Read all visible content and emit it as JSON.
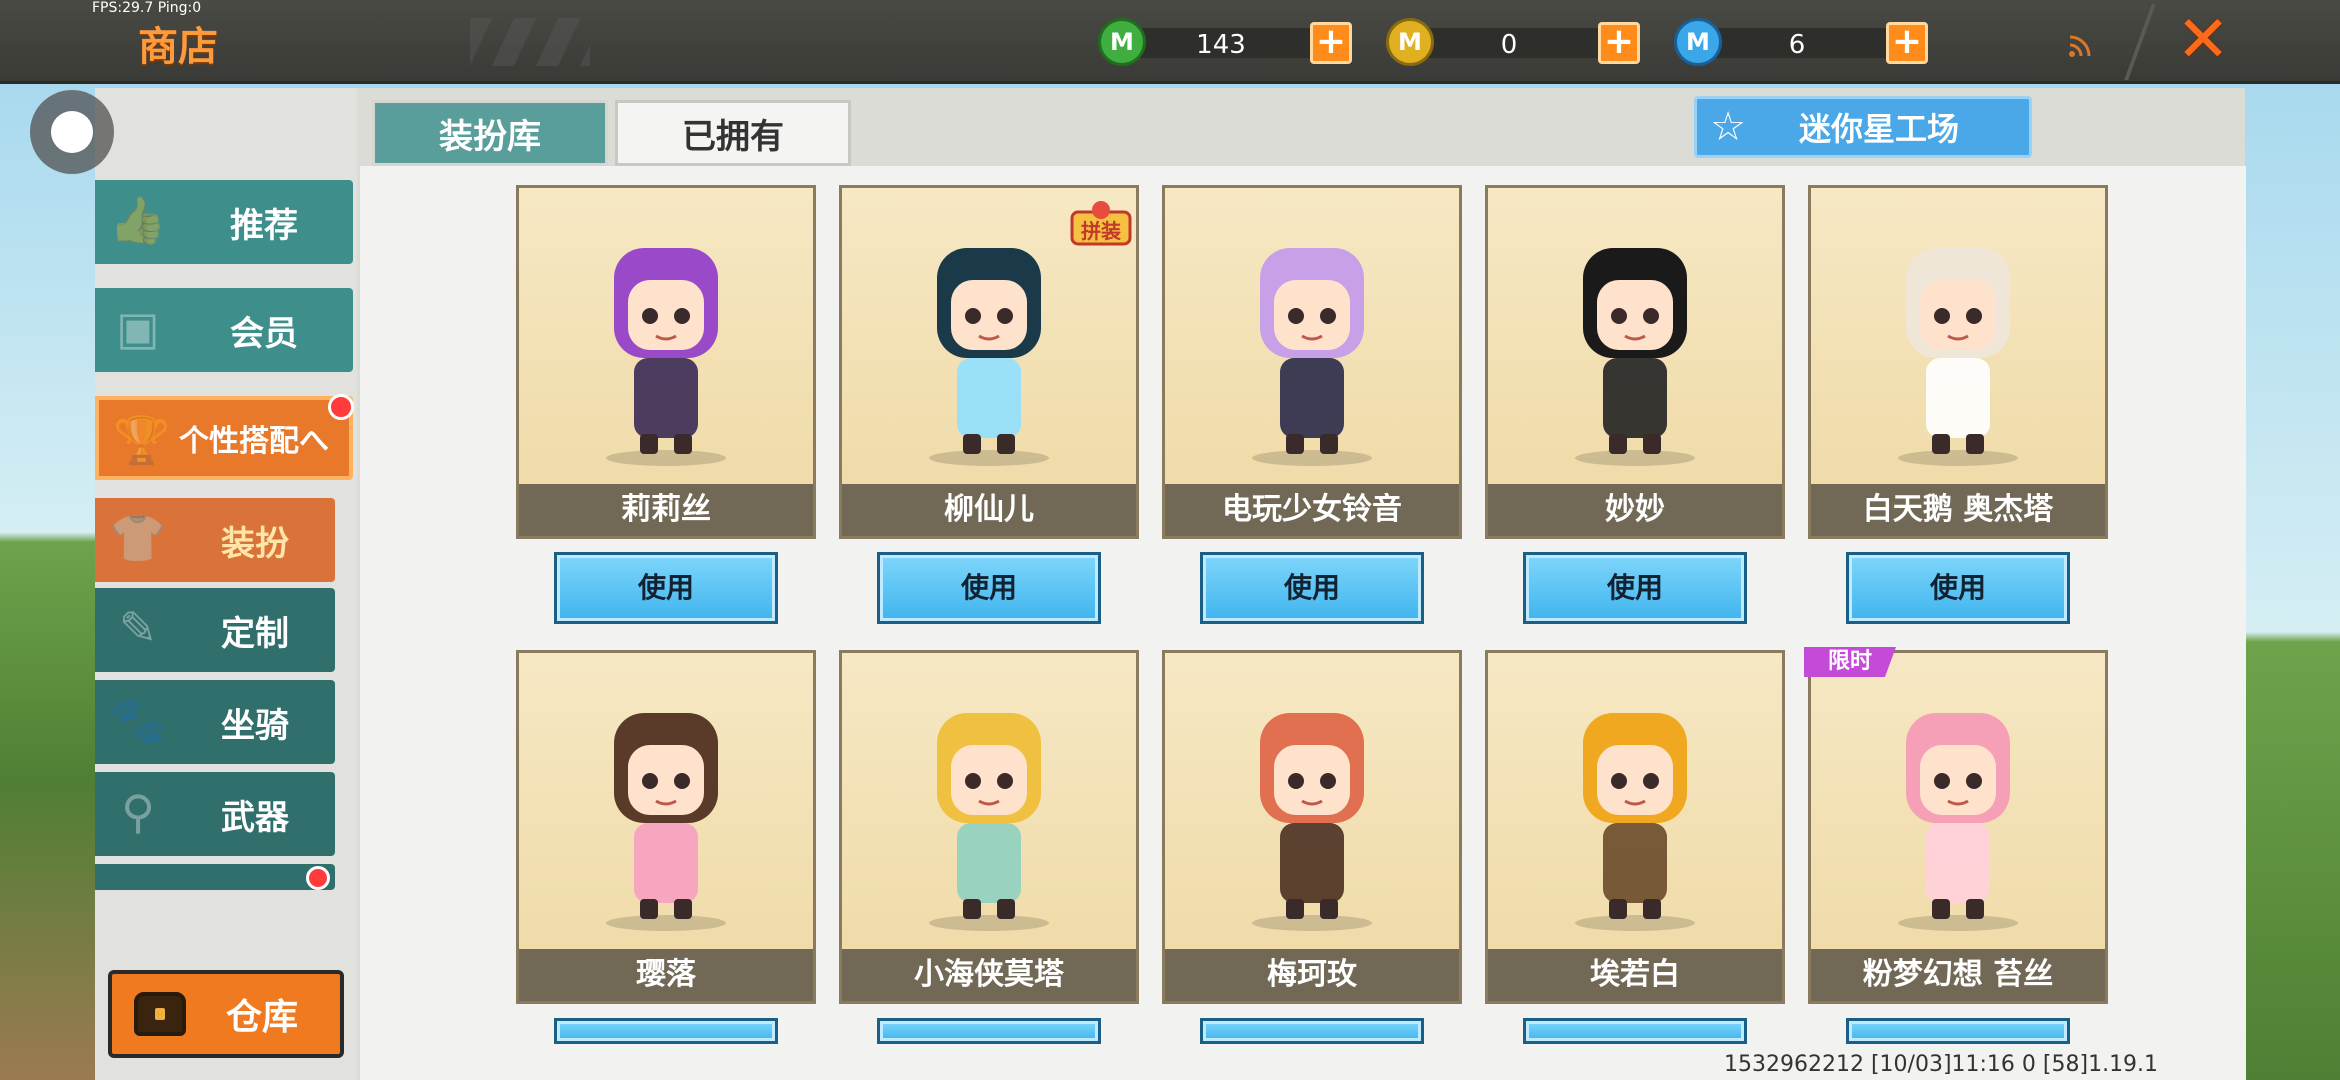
{
  "status": {
    "fps": "FPS:29.7  Ping:0"
  },
  "header": {
    "title": "商店",
    "currencies": [
      {
        "icon": "green-mini-bean-icon",
        "letter": "M",
        "amount": "143",
        "color": "#3fae3f"
      },
      {
        "icon": "gold-coin-icon",
        "letter": "M",
        "amount": "0",
        "color": "#e0b020"
      },
      {
        "icon": "blue-mini-coin-icon",
        "letter": "M",
        "amount": "6",
        "color": "#3aa8e8"
      }
    ],
    "plus": "+",
    "close": "✕"
  },
  "sidebar": {
    "items": [
      {
        "label": "推荐",
        "icon": "thumbs-up-icon"
      },
      {
        "label": "会员",
        "icon": "vip-badge-icon"
      },
      {
        "label": "个性搭配へ",
        "icon": "trophy-icon"
      },
      {
        "label": "装扮",
        "icon": "shirt-icon"
      },
      {
        "label": "定制",
        "icon": "brush-icon"
      },
      {
        "label": "坐骑",
        "icon": "paw-icon"
      },
      {
        "label": "武器",
        "icon": "gun-icon"
      }
    ],
    "storage_label": "仓库"
  },
  "tabs": {
    "library": "装扮库",
    "owned": "已拥有"
  },
  "workshop_label": "迷你星工场",
  "use_label": "使用",
  "limited_label": "限时",
  "new_badge_label": "拼装",
  "skins_row1": [
    {
      "name": "莉莉丝",
      "hair": "#9a4ac8",
      "hat": "#3a2a55"
    },
    {
      "name": "柳仙儿",
      "hair": "#1a3a4a",
      "hat": "#8fe0ff"
    },
    {
      "name": "电玩少女铃音",
      "hair": "#c8a0e8",
      "hat": "#2a2a4a"
    },
    {
      "name": "妙妙",
      "hair": "#1a1a1a",
      "hat": "#222222"
    },
    {
      "name": "白天鹅 奥杰塔",
      "hair": "#f0e6d8",
      "hat": "#ffffff"
    }
  ],
  "skins_row2": [
    {
      "name": "璎落",
      "hair": "#5a3a28",
      "hat": "#f6a0c0"
    },
    {
      "name": "小海侠莫塔",
      "hair": "#f0c040",
      "hat": "#8fd0c0"
    },
    {
      "name": "梅珂玫",
      "hair": "#e07050",
      "hat": "#4a3020"
    },
    {
      "name": "埃若白",
      "hair": "#f0a820",
      "hat": "#6a4a2a"
    },
    {
      "name": "粉梦幻想 苔丝",
      "hair": "#f6a0b8",
      "hat": "#ffd0dc"
    }
  ],
  "footer": "1532962212   [10/03]11:16 0    [58]1.19.1"
}
